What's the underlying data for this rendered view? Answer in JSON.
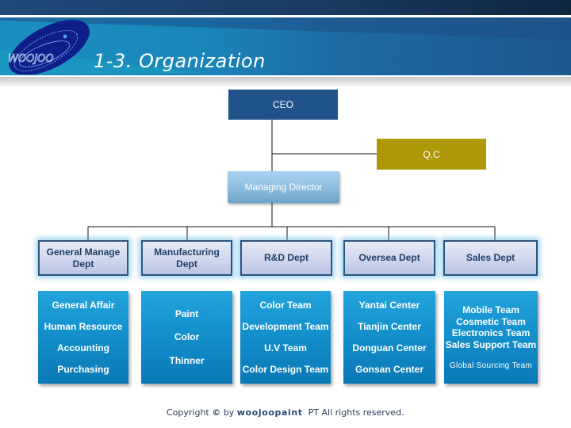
{
  "header": {
    "logo_text": "WOOJOO",
    "title": "1-3. Organization"
  },
  "chart": {
    "ceo": "CEO",
    "qc": "Q.C",
    "managing_director": "Managing Director",
    "departments": [
      {
        "name": "General Manage Dept",
        "name_lines": [
          "General Manage",
          "Dept"
        ],
        "teams": [
          "General Affair",
          "Human Resource",
          "Accounting",
          "Purchasing"
        ]
      },
      {
        "name": "Manufacturing Dept",
        "name_lines": [
          "Manufacturing Dept"
        ],
        "teams": [
          "Paint",
          "Color",
          "Thinner"
        ]
      },
      {
        "name": "R&D Dept",
        "name_lines": [
          "R&D Dept"
        ],
        "teams": [
          "Color Team",
          "Development Team",
          "U.V Team",
          "Color Design Team"
        ]
      },
      {
        "name": "Oversea Dept",
        "name_lines": [
          "Oversea Dept"
        ],
        "teams": [
          "Yantai Center",
          "Tianjin Center",
          "Donguan  Center",
          "Gonsan  Center"
        ]
      },
      {
        "name": "Sales Dept",
        "name_lines": [
          "Sales Dept"
        ],
        "teams": [
          "Mobile Team",
          "Cosmetic Team",
          "Electronics Team",
          "Sales Support Team"
        ],
        "extra_team": "Global Sourcing Team"
      }
    ]
  },
  "footer": {
    "prefix": "Copyright",
    "symbol": "©",
    "by": "by",
    "brand": "woojoopaint",
    "suffix": "PT All rights reserved."
  },
  "colors": {
    "ceo": "#20538a",
    "qc": "#ae9808",
    "managing_director": "#8fbfe0",
    "department_border": "#2b5580",
    "team_fill": "#1593cf"
  }
}
